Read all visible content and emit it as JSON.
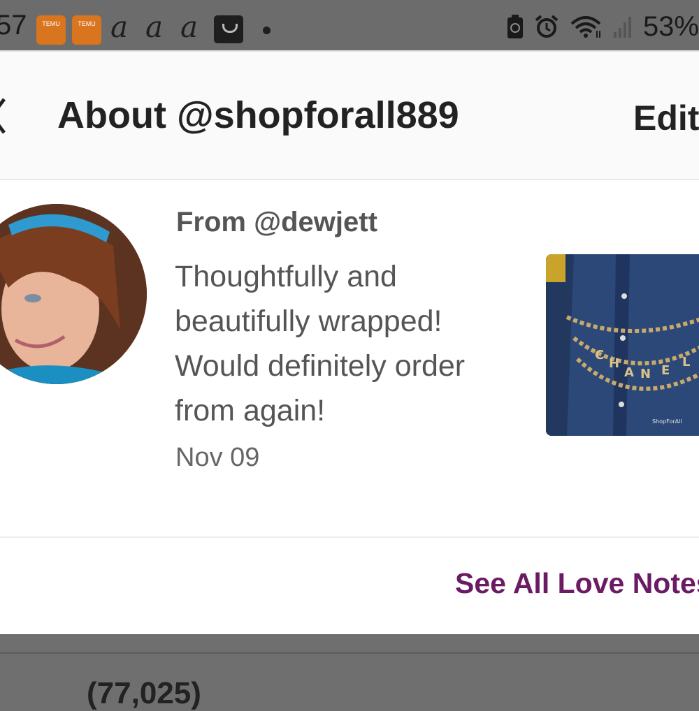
{
  "status_bar": {
    "time": "57",
    "app_icon_label": "TEMU",
    "script_letters": [
      "a",
      "a",
      "a"
    ],
    "battery": "53%"
  },
  "header": {
    "title": "About @shopforall889",
    "edit_label": "Edit"
  },
  "love_note": {
    "from": "From @dewjett",
    "text": "Thoughtfully and beautifully wrapped! Would definitely order from again!",
    "date": "Nov 09",
    "photo_watermark": "ShopForAll",
    "photo_letters": [
      "C",
      "H",
      "A",
      "N",
      "E",
      "L"
    ]
  },
  "footer": {
    "see_all_label": "See All Love Notes"
  },
  "background_text": "(77,025)",
  "colors": {
    "accent": "#6b1b63",
    "overlay": "#6f6f6f"
  },
  "icons": [
    "temu-app-icon",
    "script-a-icon",
    "shopping-bag-icon",
    "battery-saver-icon",
    "alarm-icon",
    "wifi-icon",
    "signal-icon",
    "back-chevron-icon"
  ]
}
